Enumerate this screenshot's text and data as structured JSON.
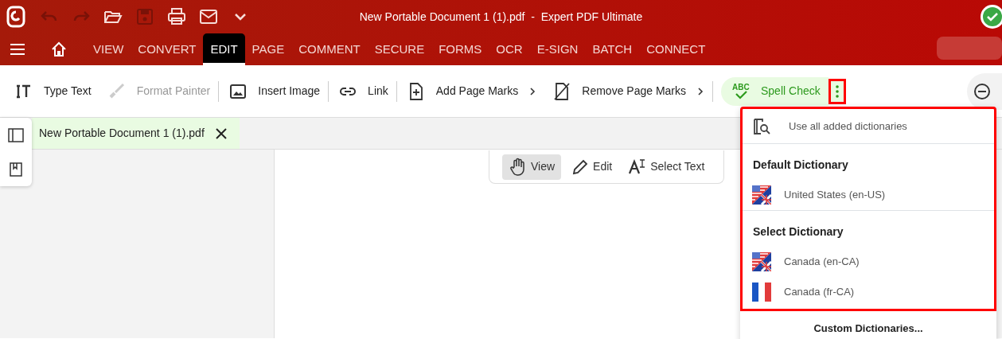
{
  "window": {
    "title": "New Portable Document 1 (1).pdf  -  Expert PDF Ultimate"
  },
  "quick_access": [
    {
      "kind": "undo",
      "disabled": true
    },
    {
      "kind": "redo",
      "disabled": true
    },
    {
      "kind": "open",
      "disabled": false
    },
    {
      "kind": "save",
      "disabled": true
    },
    {
      "kind": "print",
      "disabled": false
    },
    {
      "kind": "mail",
      "disabled": false
    },
    {
      "kind": "more",
      "disabled": false
    }
  ],
  "menu_tabs": [
    {
      "label": "VIEW",
      "selected": false
    },
    {
      "label": "CONVERT",
      "selected": false
    },
    {
      "label": "EDIT",
      "selected": true
    },
    {
      "label": "PAGE",
      "selected": false
    },
    {
      "label": "COMMENT",
      "selected": false
    },
    {
      "label": "SECURE",
      "selected": false
    },
    {
      "label": "FORMS",
      "selected": false
    },
    {
      "label": "OCR",
      "selected": false
    },
    {
      "label": "E-SIGN",
      "selected": false
    },
    {
      "label": "BATCH",
      "selected": false
    },
    {
      "label": "CONNECT",
      "selected": false
    }
  ],
  "toolbar": [
    {
      "kind": "type-text",
      "label": "Type Text",
      "disabled": false,
      "submenu": false,
      "separator_after": false
    },
    {
      "kind": "brush",
      "label": "Format Painter",
      "disabled": true,
      "submenu": false,
      "separator_after": true
    },
    {
      "kind": "image",
      "label": "Insert Image",
      "disabled": false,
      "submenu": false,
      "separator_after": true
    },
    {
      "kind": "link",
      "label": "Link",
      "disabled": false,
      "submenu": false,
      "separator_after": true
    },
    {
      "kind": "page-plus",
      "label": "Add Page Marks",
      "disabled": false,
      "submenu": true,
      "separator_after": false
    },
    {
      "kind": "page-slash",
      "label": "Remove Page Marks",
      "disabled": false,
      "submenu": true,
      "separator_after": true
    }
  ],
  "spell_check": {
    "icon_text": "ABC",
    "label": "Spell Check",
    "expanded": true
  },
  "document_tab": {
    "label": "New Portable Document 1 (1).pdf"
  },
  "view_modes": [
    {
      "kind": "hand",
      "label": "View",
      "selected": true
    },
    {
      "kind": "pencil",
      "label": "Edit",
      "selected": false
    },
    {
      "kind": "select",
      "label": "Select Text",
      "selected": false
    }
  ],
  "dictionary_menu": {
    "use_all": "Use all added dictionaries",
    "sections": [
      {
        "title": "Default Dictionary",
        "items": [
          {
            "kind": "us-uk",
            "label": "United States (en-US)"
          }
        ]
      },
      {
        "title": "Select Dictionary",
        "items": [
          {
            "kind": "us-uk",
            "label": "Canada (en-CA)"
          },
          {
            "kind": "fr",
            "label": "Canada (fr-CA)"
          }
        ]
      }
    ],
    "footer": "Custom Dictionaries..."
  }
}
